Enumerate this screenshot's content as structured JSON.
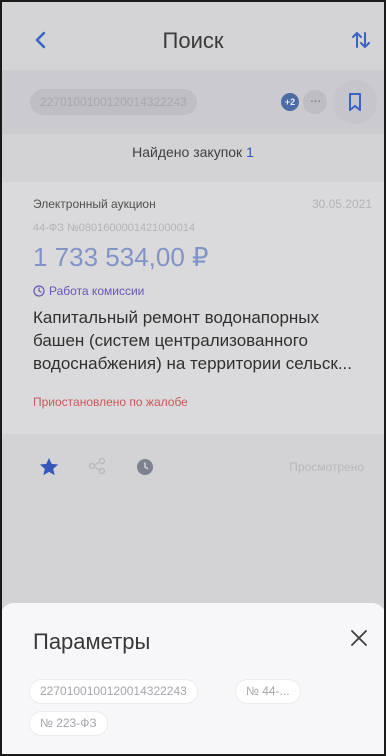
{
  "header": {
    "title": "Поиск"
  },
  "filter_bar": {
    "query_chip": "22701001001200143222​43",
    "plus_badge": "+2",
    "more_label": "···"
  },
  "results": {
    "found_label": "Найдено закупок",
    "found_count": "1"
  },
  "card": {
    "type": "Электронный аукцион",
    "date": "30.05.2021",
    "law_number": "44-ФЗ №0801600001421000014",
    "price": "1 733 534,00 ₽",
    "status": "Работа комиссии",
    "title": "Капитальный ремонт водонапорных башен (систем централизованного водоснабжения) на территории сельск...",
    "warning": "Приостановлено по жалобе",
    "viewed": "Просмотрено"
  },
  "sheet": {
    "title": "Параметры",
    "chips": [
      "227010010012001432224​3",
      "№ 44-...",
      "№ 223-ФЗ"
    ]
  },
  "colors": {
    "accent": "#3558b8",
    "status_purple": "#6a55b8",
    "warning_red": "#c75a5a"
  },
  "icons": [
    "back-arrow-icon",
    "sort-icon",
    "bookmark-icon",
    "clock-icon",
    "star-icon",
    "share-icon",
    "close-icon"
  ]
}
